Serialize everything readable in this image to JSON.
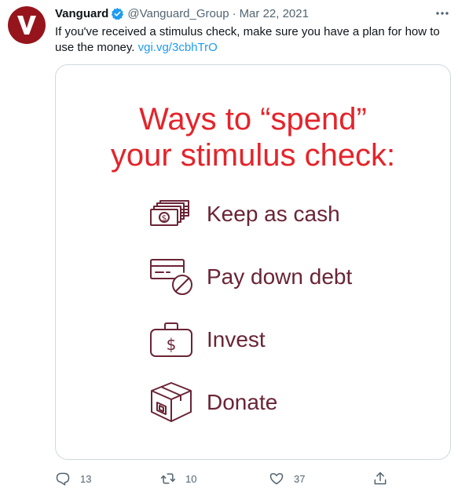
{
  "tweet": {
    "author_name": "Vanguard",
    "handle": "@Vanguard_Group",
    "separator": "·",
    "date": "Mar 22, 2021",
    "avatar_letter": "V",
    "text": "If you've received a stimulus check, make sure you have a plan for how to use the money. ",
    "link": "vgi.vg/3cbhTrO"
  },
  "card": {
    "title_line1": "Ways to “spend”",
    "title_line2": "your stimulus check:",
    "items": [
      {
        "label": "Keep as cash",
        "icon": "cash-stack-icon"
      },
      {
        "label": "Pay down debt",
        "icon": "credit-card-cancel-icon"
      },
      {
        "label": "Invest",
        "icon": "briefcase-dollar-icon"
      },
      {
        "label": "Donate",
        "icon": "donation-box-icon"
      }
    ]
  },
  "actions": {
    "replies": "13",
    "retweets": "10",
    "likes": "37"
  },
  "colors": {
    "brand": "#96151d",
    "title_red": "#e4242b",
    "item_maroon": "#6a2436",
    "link_blue": "#1d9bf0",
    "muted": "#536471"
  }
}
